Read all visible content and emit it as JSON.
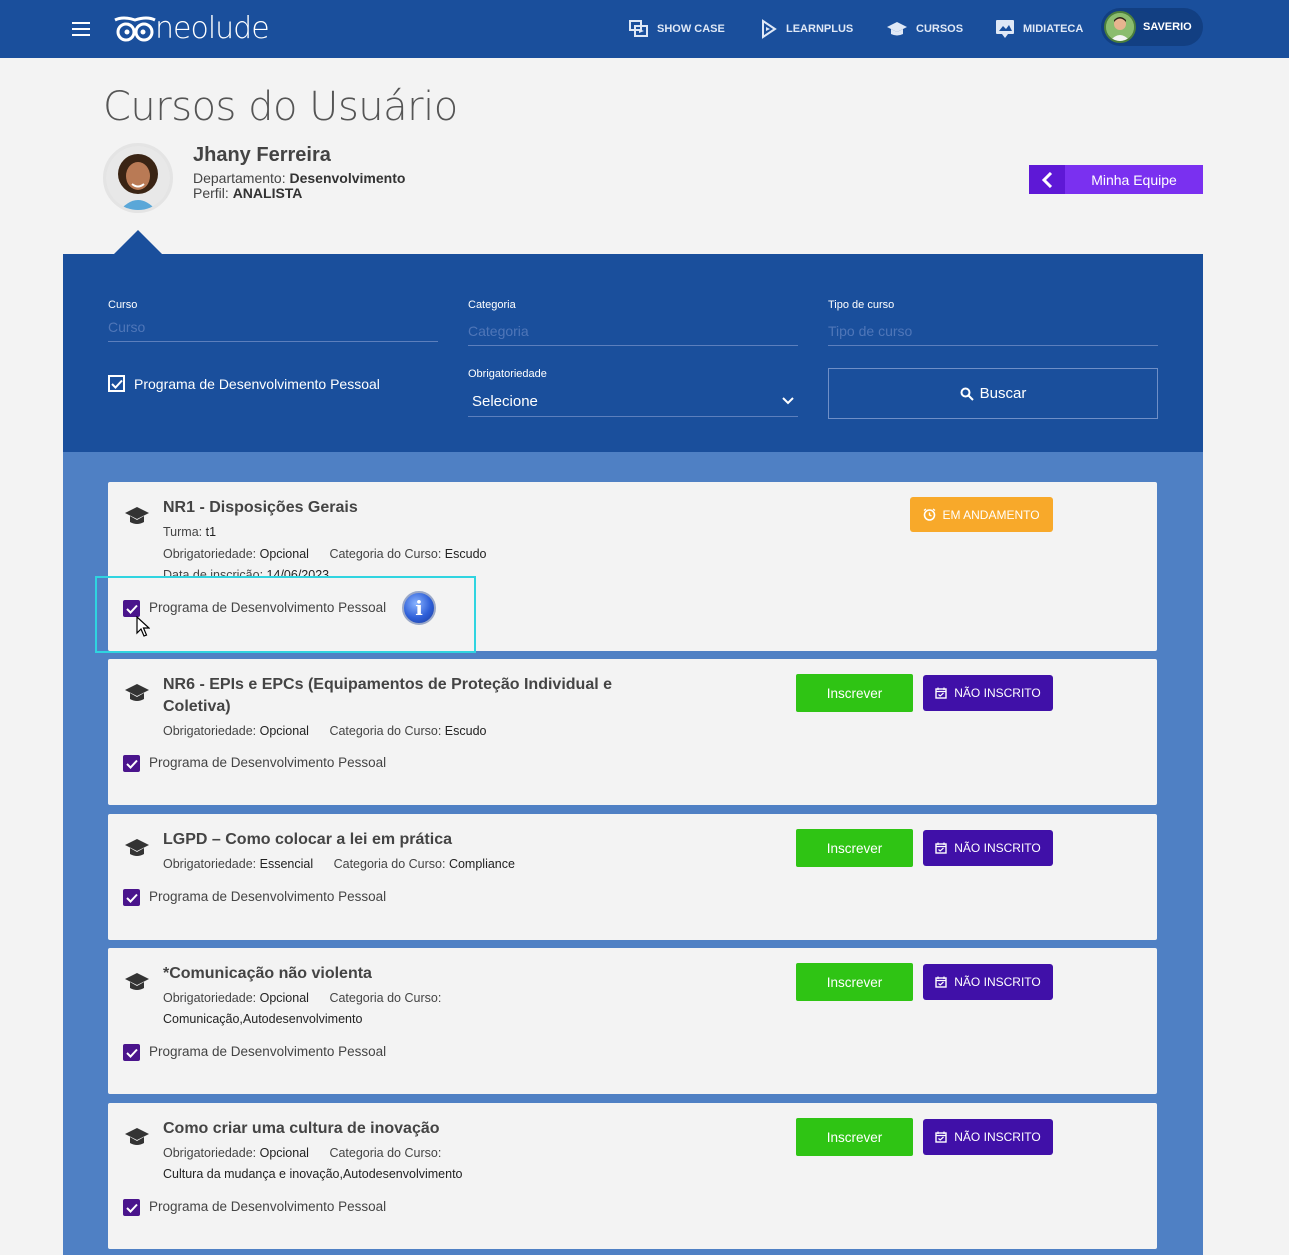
{
  "header": {
    "logo_text": "neolude",
    "nav": [
      {
        "label": "SHOW CASE",
        "icon": "showcase-icon"
      },
      {
        "label": "LEARNPLUS",
        "icon": "learnplus-icon"
      },
      {
        "label": "CURSOS",
        "icon": "graduation-cap-icon"
      },
      {
        "label": "MIDIATECA",
        "icon": "media-icon"
      }
    ],
    "user_name": "SAVERIO"
  },
  "page": {
    "title": "Cursos do Usuário",
    "user": {
      "name": "Jhany Ferreira",
      "dept_label": "Departamento:",
      "dept_value": "Desenvolvimento",
      "perfil_label": "Perfil:",
      "perfil_value": "ANALISTA"
    },
    "team_button": "Minha Equipe"
  },
  "filter": {
    "curso_label": "Curso",
    "curso_placeholder": "Curso",
    "categoria_label": "Categoria",
    "categoria_placeholder": "Categoria",
    "tipo_label": "Tipo de curso",
    "tipo_placeholder": "Tipo de curso",
    "pdp_label": "Programa de Desenvolvimento Pessoal",
    "pdp_checked": true,
    "obrig_label": "Obrigatoriedade",
    "obrig_value": "Selecione",
    "buscar": "Buscar"
  },
  "courses": [
    {
      "title": "NR1 - Disposições Gerais",
      "turma_label": "Turma:",
      "turma": "t1",
      "obrig_label": "Obrigatoriedade:",
      "obrig": "Opcional",
      "cat_label": "Categoria do Curso:",
      "cat": "Escudo",
      "date_label": "Data de inscrição:",
      "date": "14/06/2023",
      "pdp": "Programa de Desenvolvimento Pessoal",
      "status": "EM ANDAMENTO"
    },
    {
      "title_line1": "NR6 - EPIs e EPCs (Equipamentos de Proteção Individual e",
      "title_line2": "Coletiva)",
      "obrig_label": "Obrigatoriedade:",
      "obrig": "Opcional",
      "cat_label": "Categoria do Curso:",
      "cat": "Escudo",
      "pdp": "Programa de Desenvolvimento Pessoal",
      "action": "Inscrever",
      "status": "NÃO INSCRITO"
    },
    {
      "title": "LGPD – Como colocar a lei em prática",
      "obrig_label": "Obrigatoriedade:",
      "obrig": "Essencial",
      "cat_label": "Categoria do Curso:",
      "cat": "Compliance",
      "pdp": "Programa de Desenvolvimento Pessoal",
      "action": "Inscrever",
      "status": "NÃO INSCRITO"
    },
    {
      "title": "*Comunicação não violenta",
      "obrig_label": "Obrigatoriedade:",
      "obrig": "Opcional",
      "cat_label": "Categoria do Curso:",
      "cat": "Comunicação,Autodesenvolvimento",
      "pdp": "Programa de Desenvolvimento Pessoal",
      "action": "Inscrever",
      "status": "NÃO INSCRITO"
    },
    {
      "title": "Como criar uma cultura de inovação",
      "obrig_label": "Obrigatoriedade:",
      "obrig": "Opcional",
      "cat_label": "Categoria do Curso:",
      "cat": "Cultura da mudança e inovação,Autodesenvolvimento",
      "pdp": "Programa de Desenvolvimento Pessoal",
      "action": "Inscrever",
      "status": "NÃO INSCRITO"
    }
  ],
  "colors": {
    "header_bg": "#1a4f9c",
    "list_bg": "#4f80c4",
    "inscrever": "#2fc414",
    "nao_inscrito": "#4010a8",
    "em_andamento": "#f8a92a",
    "team_button": "#7a30f0"
  }
}
